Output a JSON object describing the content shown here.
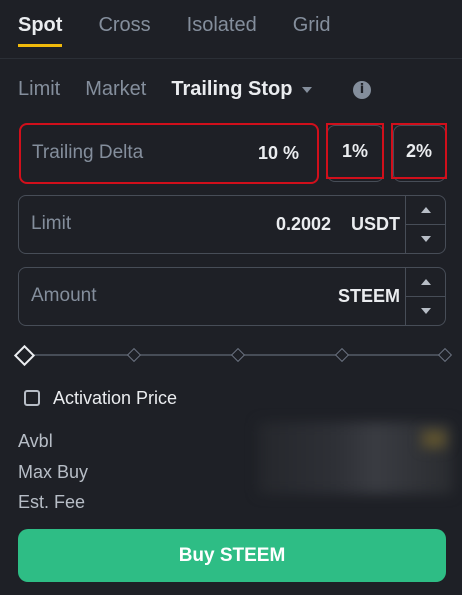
{
  "tabs": [
    {
      "label": "Spot",
      "active": true
    },
    {
      "label": "Cross",
      "active": false
    },
    {
      "label": "Isolated",
      "active": false
    },
    {
      "label": "Grid",
      "active": false
    }
  ],
  "order_types": {
    "limit": "Limit",
    "market": "Market",
    "trailing_stop": "Trailing Stop",
    "caret_icon": "chevron-down-icon",
    "info_icon": "info-icon"
  },
  "trailing_delta": {
    "label": "Trailing Delta",
    "value": "10 %",
    "preset_1": "1%",
    "preset_2": "2%"
  },
  "limit": {
    "label": "Limit",
    "value": "0.2002",
    "unit": "USDT"
  },
  "amount": {
    "label": "Amount",
    "unit": "STEEM"
  },
  "slider": {
    "value_percent": 0,
    "marks": [
      0,
      25,
      50,
      75,
      100
    ]
  },
  "activation_price": {
    "label": "Activation Price",
    "checked": false
  },
  "summary": {
    "avbl": "Avbl",
    "max_buy": "Max Buy",
    "est_fee": "Est. Fee"
  },
  "buy_button": {
    "label": "Buy STEEM"
  },
  "colors": {
    "background": "#1e2026",
    "accent": "#f0b90b",
    "buy": "#2ebd85",
    "highlight_border": "#d10f1b"
  }
}
